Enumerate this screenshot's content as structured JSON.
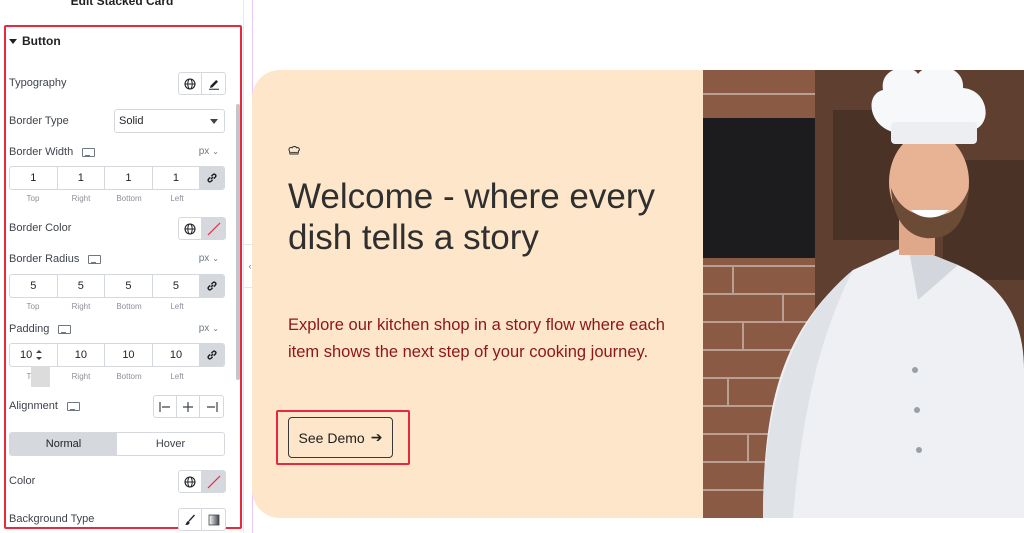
{
  "panel": {
    "title": "Edit Stacked Card",
    "section": "Button",
    "typography_label": "Typography",
    "border_type": {
      "label": "Border Type",
      "value": "Solid"
    },
    "border_width": {
      "label": "Border Width",
      "unit": "px",
      "values": [
        "1",
        "1",
        "1",
        "1"
      ]
    },
    "border_color": {
      "label": "Border Color"
    },
    "border_radius": {
      "label": "Border Radius",
      "unit": "px",
      "values": [
        "5",
        "5",
        "5",
        "5"
      ]
    },
    "padding": {
      "label": "Padding",
      "unit": "px",
      "values": [
        "10",
        "10",
        "10",
        "10"
      ]
    },
    "dim_labels": [
      "Top",
      "Right",
      "Bottom",
      "Left"
    ],
    "alignment_label": "Alignment",
    "tabs": [
      "Normal",
      "Hover"
    ],
    "color_label": "Color",
    "background_type_label": "Background Type",
    "unit_chevron": "⌄"
  },
  "card": {
    "title": "Welcome - where every dish tells a story",
    "text": "Explore our kitchen shop in a story flow where each item shows the next step of your cooking journey.",
    "button_label": "See Demo",
    "button_arrow": "➔"
  },
  "colors": {
    "card_bg": "#fde6c9",
    "text_accent": "#8e1616",
    "highlight": "#e8283d"
  }
}
